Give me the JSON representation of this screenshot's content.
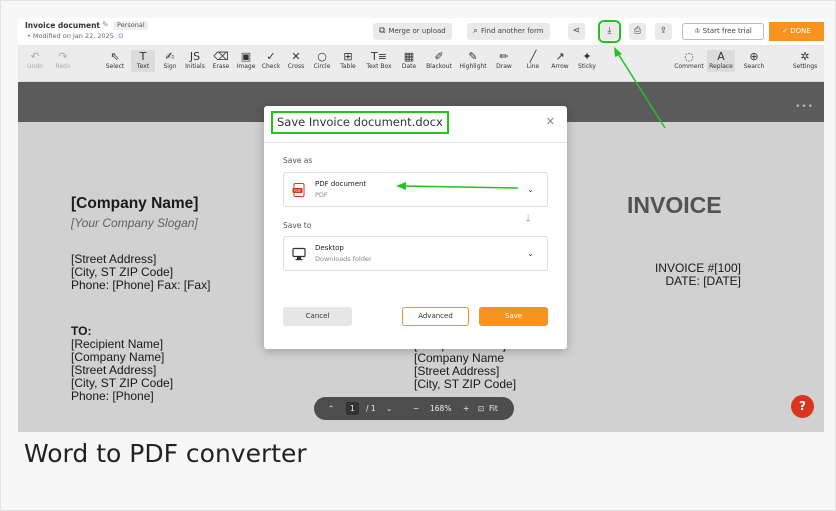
{
  "document": {
    "title": "Invoice document",
    "badge": "Personal",
    "modified": "Modified on Jan 22, 2025"
  },
  "topbar": {
    "merge_label": "Merge or upload",
    "find_label": "Find another form",
    "trial_label": "Start free trial",
    "done_label": "DONE"
  },
  "toolbar": {
    "tools": [
      "Undo",
      "Redo",
      "Select",
      "Text",
      "Sign",
      "Initials",
      "Erase",
      "Image",
      "Check",
      "Cross",
      "Circle",
      "Table",
      "Text Box",
      "Date",
      "Blackout",
      "Highlight",
      "Draw",
      "Line",
      "Arrow",
      "Sticky"
    ],
    "right_tools": [
      "Comment",
      "Replace",
      "Search",
      "Settings"
    ]
  },
  "invoice": {
    "company_name": "[Company Name]",
    "company_slogan": "[Your Company Slogan]",
    "address_lines": [
      "[Street Address]",
      "[City, ST ZIP Code]",
      "Phone: [Phone]  Fax: [Fax]"
    ],
    "title": "INVOICE",
    "meta_lines": [
      "INVOICE #[100]",
      "DATE: [DATE]"
    ],
    "to_lines": [
      "TO:",
      "[Recipient Name]",
      "[Company Name]",
      "[Street Address]",
      "[City, ST ZIP Code]",
      "Phone: [Phone]"
    ],
    "right_lines": [
      "[Recipient Name]",
      "[Company Name",
      "[Street Address]",
      "[City, ST ZIP Code]"
    ]
  },
  "dialog": {
    "title": "Save Invoice document.docx",
    "save_as_label": "Save as",
    "save_as_value": "PDF document",
    "save_as_sub": "PDF",
    "save_to_label": "Save to",
    "save_to_value": "Desktop",
    "save_to_sub": "Downloads folder",
    "cancel": "Cancel",
    "advanced": "Advanced",
    "save": "Save"
  },
  "zoom": {
    "page_current": "1",
    "page_total": "/ 1",
    "zoom_level": "168%",
    "fit_label": "Fit"
  },
  "help_label": "?",
  "caption": "Word to PDF converter",
  "colors": {
    "accent": "#f7931e",
    "highlight": "#21c321",
    "link": "#2e7cd6"
  }
}
